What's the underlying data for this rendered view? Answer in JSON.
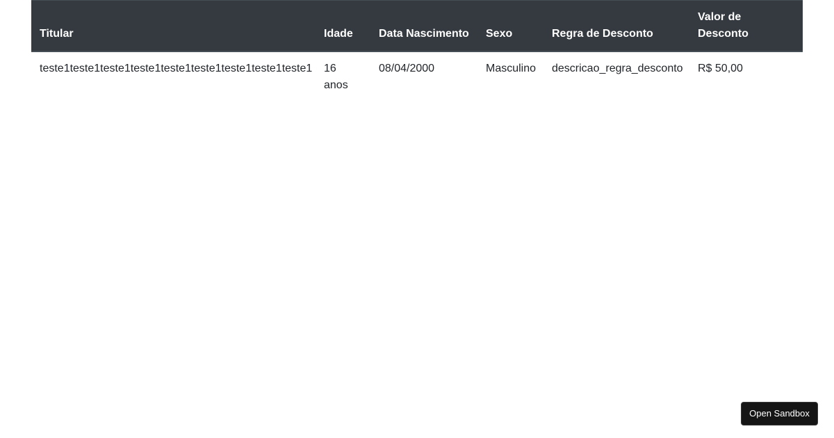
{
  "table": {
    "headers": {
      "titular": "Titular",
      "idade": "Idade",
      "data_nascimento": "Data Nascimento",
      "sexo": "Sexo",
      "regra_desconto": "Regra de Desconto",
      "valor_desconto": "Valor de Desconto"
    },
    "rows": [
      {
        "titular": "teste1teste1teste1teste1teste1teste1teste1teste1teste1",
        "idade": "16 anos",
        "data_nascimento": "08/04/2000",
        "sexo": "Masculino",
        "regra_desconto": "descricao_regra_desconto",
        "valor_desconto": "R$ 50,00"
      }
    ]
  },
  "sandbox": {
    "button_label": "Open Sandbox"
  }
}
